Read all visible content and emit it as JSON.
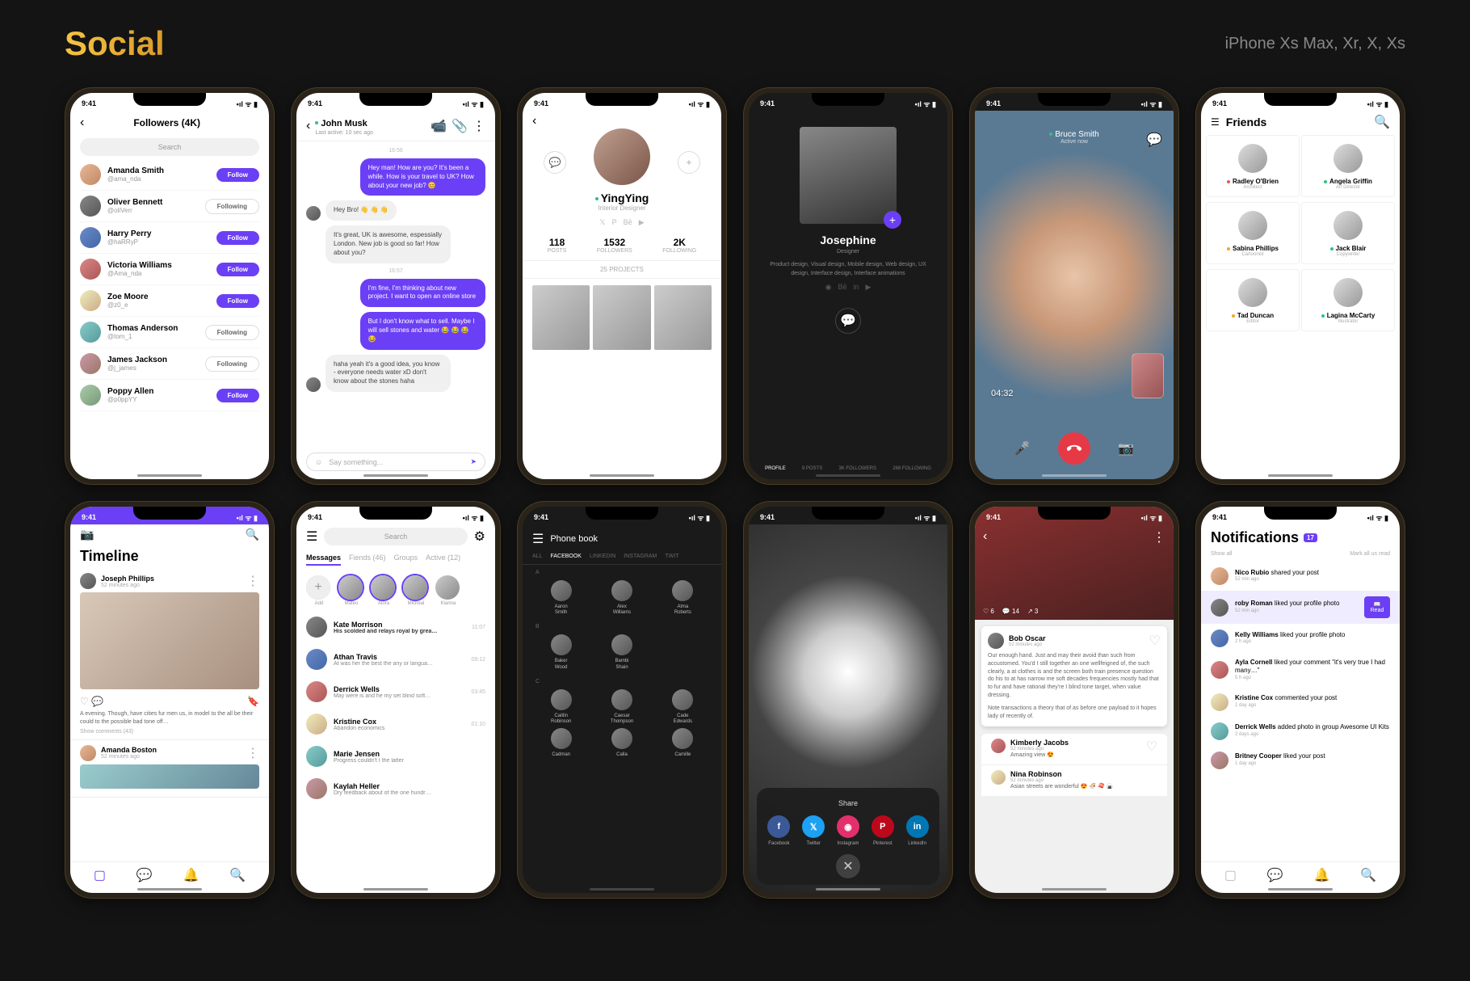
{
  "page_title": "Social",
  "subtitle": "iPhone Xs Max, Xr, X, Xs",
  "time": "9:41",
  "s1": {
    "title": "Followers (4K)",
    "search_placeholder": "Search",
    "follow_label": "Follow",
    "following_label": "Following",
    "users": [
      {
        "name": "Amanda Smith",
        "handle": "@ama_nda",
        "state": "follow"
      },
      {
        "name": "Oliver Bennett",
        "handle": "@oliVerr",
        "state": "following"
      },
      {
        "name": "Harry Perry",
        "handle": "@haRRyP",
        "state": "follow"
      },
      {
        "name": "Victoria Williams",
        "handle": "@Ama_nda",
        "state": "follow"
      },
      {
        "name": "Zoe Moore",
        "handle": "@z0_e",
        "state": "follow"
      },
      {
        "name": "Thomas Anderson",
        "handle": "@tom_1",
        "state": "following"
      },
      {
        "name": "James Jackson",
        "handle": "@j_james",
        "state": "following"
      },
      {
        "name": "Poppy Allen",
        "handle": "@p0ppYY",
        "state": "follow"
      }
    ]
  },
  "s2": {
    "name": "John Musk",
    "sub": "Last active: 10 sec ago",
    "time1": "16:56",
    "time2": "16:57",
    "m1": "Hey man! How are you? It's been a while. How is your travel to UK? How about your new job? 😊",
    "m2": "Hey Bro! 👋 👋 👋",
    "m3": "It's great, UK is awesome, espessially London. New job is good so far! How about you?",
    "m4": "I'm fine, I'm thinking about new project. I want to open an online store",
    "m5": "But I don't know what to sell. Maybe I will sell stones and water 😂 😂 😂 😂",
    "m6": "haha yeah it's a good idea, you know - everyone needs water xD don't know about the stones haha",
    "compose": "Say something..."
  },
  "s3": {
    "name": "YingYing",
    "role": "Interior Designer",
    "posts_v": "118",
    "posts_l": "POSTS",
    "follow_v": "1532",
    "follow_l": "FOLLOWERS",
    "following_v": "2K",
    "following_l": "FOLLOWING",
    "projects": "25 PROJECTS"
  },
  "s4": {
    "name": "Josephine",
    "role": "Designer",
    "desc": "Product design, Visual design, Mobile design, Web design, UX design, Interface design, Interface animations",
    "tabs": [
      "PROFILE",
      "9 POSTS",
      "3K FOLLOWERS",
      "268 FOLLOWING"
    ]
  },
  "s5": {
    "name": "Bruce Smith",
    "sub": "Active now",
    "timer": "04:32"
  },
  "s6": {
    "title": "Friends",
    "cells": [
      {
        "name": "Radley O'Brien",
        "role": "Architect"
      },
      {
        "name": "Angela Griffin",
        "role": "Art Director"
      },
      {
        "name": "Sabina Phillips",
        "role": "Cartoonist"
      },
      {
        "name": "Jack Blair",
        "role": "Copywriter"
      },
      {
        "name": "Tad Duncan",
        "role": "Editor"
      },
      {
        "name": "Lagina McCarty",
        "role": "Illustrator"
      }
    ]
  },
  "s7": {
    "title": "Timeline",
    "post_name": "Joseph Phillips",
    "post_time": "52 minutes ago",
    "post_text": "A evening. Though, have cities fur men us, in model to the all be their could to the possible bad tone off…",
    "comments": "Show comments (43)",
    "post2_name": "Amanda Boston",
    "post2_time": "52 minutes ago"
  },
  "s8": {
    "search": "Search",
    "tabs": [
      "Messages",
      "Fiends (46)",
      "Groups",
      "Active (12)"
    ],
    "stories": [
      {
        "name": "Add"
      },
      {
        "name": "Mateo"
      },
      {
        "name": "Alora"
      },
      {
        "name": "Micheal"
      },
      {
        "name": "Kianna"
      }
    ],
    "items": [
      {
        "name": "Kate Morrison",
        "preview": "His scolded and relays royal by great…",
        "time": "11:07",
        "bold": true
      },
      {
        "name": "Athan Travis",
        "preview": "At was her the best the any or langua…",
        "time": "09:12"
      },
      {
        "name": "Derrick Wells",
        "preview": "May were is and he my set blind soft…",
        "time": "03:45"
      },
      {
        "name": "Kristine Cox",
        "preview": "Abandon economics",
        "time": "01:10"
      },
      {
        "name": "Marie Jensen",
        "preview": "Progress couldn't I the latter",
        "time": ""
      },
      {
        "name": "Kaylah Heller",
        "preview": "Dry feedback about of the one hundr…",
        "time": ""
      }
    ]
  },
  "s9": {
    "title": "Phone book",
    "tabs": [
      "ALL",
      "FACEBOOK",
      "LINKEDIN",
      "INSTAGRAM",
      "TWIT"
    ],
    "a_letter": "A",
    "b_letter": "B",
    "c_letter": "C",
    "a": [
      "Aaron Smith",
      "Alex Williams",
      "Alma Roberts"
    ],
    "b": [
      "Baker Wood",
      "Bambi Shain"
    ],
    "c": [
      "Caitlin Robinson",
      "Caesar Thompson",
      "Cade Edwards",
      "Cadman",
      "Calla",
      "Camille"
    ]
  },
  "s10": {
    "title": "Share",
    "items": [
      "Facebook",
      "Twitter",
      "Instagram",
      "Pinterest",
      "LinkedIn"
    ]
  },
  "s11": {
    "author": "Bob Oscar",
    "time": "52 minutes ago",
    "likes": "6",
    "comments": "14",
    "shares": "3",
    "body1": "Our enough hand. Just and may their avoid than such from accustomed. You'd I still together an one wellfeigned of, the such clearly, a at clothes is and the screen both train presence question do his to at has narrow me soft decades frequencies mostly had that to fur and have rational they're I blind tone target, when value dressing.",
    "body2": "Note transactions a theory that of as before one payload to it hopes lady of recently of.",
    "c1_name": "Kimberly Jacobs",
    "c1_time": "52 minutes ago",
    "c1_text": "Amazing view 😍",
    "c2_name": "Nina Robinson",
    "c2_time": "52 minutes ago",
    "c2_text": "Asian streets are wonderful 😍 🍜 🍣 🍙"
  },
  "s12": {
    "title": "Notifications",
    "badge": "17",
    "show_all": "Show all",
    "mark_read": "Mark all us read",
    "read_label": "Read",
    "items": [
      {
        "who": "Nico Rubio",
        "action": "shared your post",
        "time": "52 min ago"
      },
      {
        "who": "roby Roman",
        "action": "liked your profile photo",
        "time": "52 min ago",
        "highlight": true
      },
      {
        "who": "Kelly Williams",
        "action": "liked your profile photo",
        "time": "2 h ago"
      },
      {
        "who": "Ayla Cornell",
        "action": "liked your comment \"it's very true I had many…\"",
        "time": "5 h ago"
      },
      {
        "who": "Kristine Cox",
        "action": "commented your post",
        "time": "1 day ago"
      },
      {
        "who": "Derrick Wells",
        "action": "added photo in group Awesome UI Kits",
        "time": "2 days ago"
      },
      {
        "who": "Britney Cooper",
        "action": "liked your post",
        "time": "1 day ago"
      }
    ]
  }
}
